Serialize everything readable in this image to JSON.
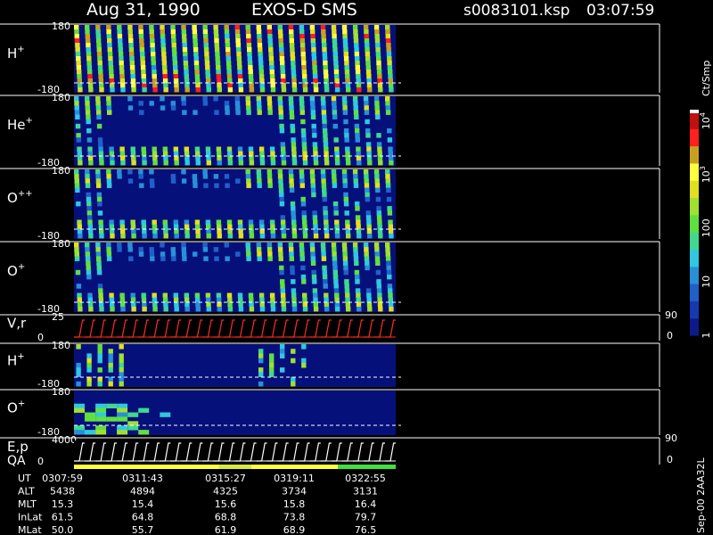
{
  "header": {
    "date": "Aug 31, 1990",
    "instrument": "EXOS-D SMS",
    "file": "s0083101.ksp",
    "time": "03:07:59"
  },
  "colorbar": {
    "title": "Ct/Smp",
    "ticks": [
      {
        "label": "1",
        "value": 1
      },
      {
        "label": "10",
        "value": 10
      },
      {
        "label": "100",
        "value": 100
      },
      {
        "label": "10",
        "sup": "3",
        "value": 1000
      },
      {
        "label": "10",
        "sup": "4",
        "value": 10000
      }
    ],
    "range": [
      1,
      15000
    ],
    "log": true
  },
  "side_label": "Sep-00 2AA32L",
  "chart_data": {
    "type": "heatmap",
    "panels": [
      {
        "id": "hplus-1",
        "species": "H",
        "charge": "+",
        "ytop": "180",
        "ybot": "-180",
        "ylim": [
          -180,
          180
        ],
        "pattern": "spin",
        "intensity": "high"
      },
      {
        "id": "heplus",
        "species": "He",
        "charge": "+",
        "ytop": "180",
        "ybot": "-180",
        "ylim": [
          -180,
          180
        ],
        "pattern": "spin",
        "intensity": "medium"
      },
      {
        "id": "oplusplus",
        "species": "O",
        "charge": "++",
        "ytop": "180",
        "ybot": "-180",
        "ylim": [
          -180,
          180
        ],
        "pattern": "spin",
        "intensity": "medium"
      },
      {
        "id": "oplus-1",
        "species": "O",
        "charge": "+",
        "ytop": "180",
        "ybot": "-180",
        "ylim": [
          -180,
          180
        ],
        "pattern": "spin",
        "intensity": "medium"
      },
      {
        "id": "vr",
        "species": "V,r",
        "charge": "",
        "ytop": "25",
        "ybot": "0",
        "ylim": [
          0,
          25
        ],
        "right_top": "90",
        "right_bot": "0",
        "pattern": "ramp",
        "line_color": "#ff2a2a"
      },
      {
        "id": "hplus-2",
        "species": "H",
        "charge": "+",
        "ytop": "180",
        "ybot": "-180",
        "ylim": [
          -180,
          180
        ],
        "pattern": "sparse",
        "intensity": "low"
      },
      {
        "id": "oplus-2",
        "species": "O",
        "charge": "+",
        "ytop": "180",
        "ybot": "-180",
        "ylim": [
          -180,
          180
        ],
        "pattern": "early",
        "intensity": "low"
      },
      {
        "id": "ep",
        "species": "E,p",
        "species2": "QA",
        "charge": "",
        "ytop": "4000",
        "ybot": "0",
        "ylim": [
          0,
          4000
        ],
        "right_top": "90",
        "right_bot": "0",
        "pattern": "ramp",
        "line_color": "#ffffff"
      }
    ],
    "spin_columns": 30,
    "quality_bar": [
      {
        "from": 0,
        "to": 0.45,
        "color": "#ffff40"
      },
      {
        "from": 0.45,
        "to": 0.55,
        "color": "#d8e840"
      },
      {
        "from": 0.55,
        "to": 0.82,
        "color": "#ffff40"
      },
      {
        "from": 0.82,
        "to": 1.0,
        "color": "#40e040"
      }
    ],
    "time_rows": [
      {
        "label": "UT",
        "values": [
          "0307:59",
          "0311:43",
          "0315:27",
          "0319:11",
          "0322:55"
        ]
      },
      {
        "label": "ALT",
        "values": [
          "5438",
          "4894",
          "4325",
          "3734",
          "3131"
        ]
      },
      {
        "label": "MLT",
        "values": [
          "15.3",
          "15.4",
          "15.6",
          "15.8",
          "16.4"
        ]
      },
      {
        "label": "InLat",
        "values": [
          "61.5",
          "64.8",
          "68.8",
          "73.8",
          "79.7"
        ]
      },
      {
        "label": "MLat",
        "values": [
          "50.0",
          "55.7",
          "61.9",
          "68.9",
          "76.5"
        ]
      }
    ]
  }
}
